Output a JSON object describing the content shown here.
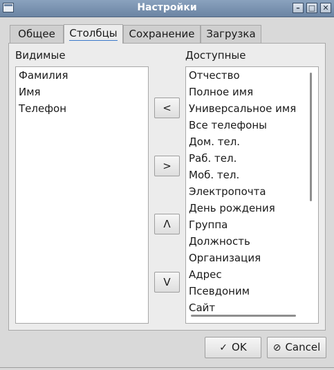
{
  "window": {
    "title": "Настройки"
  },
  "tabs": [
    {
      "label": "Общее",
      "active": false
    },
    {
      "label": "Столбцы",
      "active": true
    },
    {
      "label": "Сохранение",
      "active": false
    },
    {
      "label": "Загрузка",
      "active": false
    }
  ],
  "visible": {
    "label": "Видимые",
    "items": [
      "Фамилия",
      "Имя",
      "Телефон"
    ]
  },
  "available": {
    "label": "Доступные",
    "items": [
      "Отчество",
      "Полное имя",
      "Универсальное имя",
      "Все телефоны",
      "Дом. тел.",
      "Раб. тел.",
      "Моб. тел.",
      "Электропочта",
      "День рождения",
      "Группа",
      "Должность",
      "Организация",
      "Адрес",
      "Псевдоним",
      "Сайт"
    ]
  },
  "buttons": {
    "move_left": "<",
    "move_right": ">",
    "move_up": "Λ",
    "move_down": "V",
    "ok": "OK",
    "cancel": "Cancel"
  },
  "icons": {
    "ok": "check-icon",
    "cancel": "cancel-icon"
  }
}
